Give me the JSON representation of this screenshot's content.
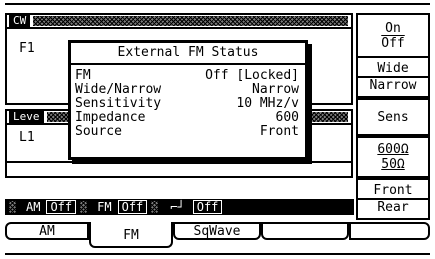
{
  "carrier_panel": {
    "label": "CW",
    "field": "F1"
  },
  "level_panel": {
    "label": "Leve",
    "field": "L1"
  },
  "dialog": {
    "title": "External FM Status",
    "rows": [
      {
        "label": "FM",
        "value": "Off [Locked]"
      },
      {
        "label": "Wide/Narrow",
        "value": "Narrow"
      },
      {
        "label": "Sensitivity",
        "value": "10 MHz/v"
      },
      {
        "label": "Impedance",
        "value": "600"
      },
      {
        "label": "Source",
        "value": "Front"
      }
    ]
  },
  "softkeys": {
    "on_off": {
      "top": "On",
      "bottom": "Off"
    },
    "wide_narrow": {
      "top": "Wide",
      "bottom": "Narrow"
    },
    "sens": {
      "label": "Sens"
    },
    "impedance": {
      "top": "600Ω",
      "bottom": "50Ω"
    },
    "front_rear": {
      "top": "Front",
      "bottom": "Rear"
    }
  },
  "status_bar": [
    {
      "label": "AM",
      "state": "Off"
    },
    {
      "label": "FM",
      "state": "Off"
    },
    {
      "label": "⌐┘",
      "state": "Off"
    }
  ],
  "bottom_tabs": [
    "AM",
    "FM",
    "SqWave",
    "",
    ""
  ]
}
